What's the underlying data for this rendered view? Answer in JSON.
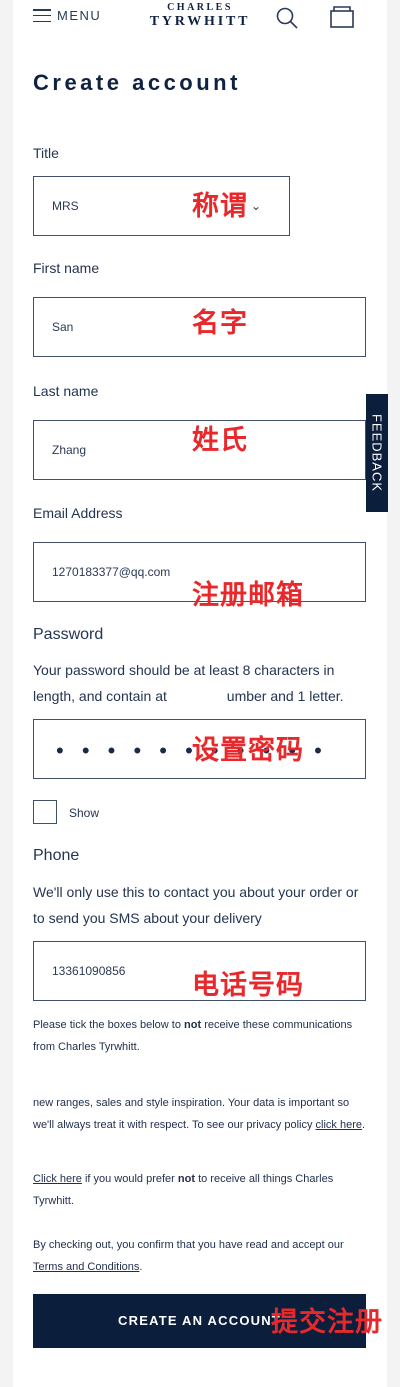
{
  "header": {
    "menu_label": "MENU",
    "logo_line1": "CHARLES",
    "logo_line2": "TYRWHITT"
  },
  "page_title": "Create account",
  "fields": {
    "title": {
      "label": "Title",
      "value": "MRS",
      "annotation": "称谓"
    },
    "first_name": {
      "label": "First name",
      "value": "San",
      "annotation": "名字"
    },
    "last_name": {
      "label": "Last name",
      "value": "Zhang",
      "annotation": "姓氏"
    },
    "email": {
      "label": "Email Address",
      "value": "1270183377@qq.com",
      "annotation": "注册邮箱"
    },
    "password": {
      "label": "Password",
      "hint_part1": "Your password should be at least 8 characters in length, and contain at ",
      "hint_part2": "umber and 1 letter.",
      "value": "• • • • • • • • • • •",
      "annotation": "设置密码",
      "show_label": "Show"
    },
    "phone": {
      "label": "Phone",
      "hint": "We'll only use this to contact you about your order or to send you SMS about your delivery",
      "value": "13361090856",
      "annotation": "电话号码"
    }
  },
  "consent": {
    "tick_text_1": "Please tick the boxes below to ",
    "tick_bold": "not",
    "tick_text_2": " receive these communications from Charles Tyrwhitt.",
    "ranges_text": "new ranges, sales and style inspiration. Your data is important so we'll always treat it with respect. To see our privacy policy ",
    "ranges_link": "click here",
    "click_here": "Click here",
    "prefer_text_1": " if you would prefer ",
    "prefer_bold": "not",
    "prefer_text_2": " to receive all things Charles Tyrwhitt.",
    "checkout_text": "By checking out, you confirm that you have read and accept our ",
    "terms_link": "Terms and Conditions"
  },
  "feedback_label": "FEEDBACK",
  "submit": {
    "label": "CREATE AN ACCOUNT",
    "annotation": "提交注册"
  }
}
